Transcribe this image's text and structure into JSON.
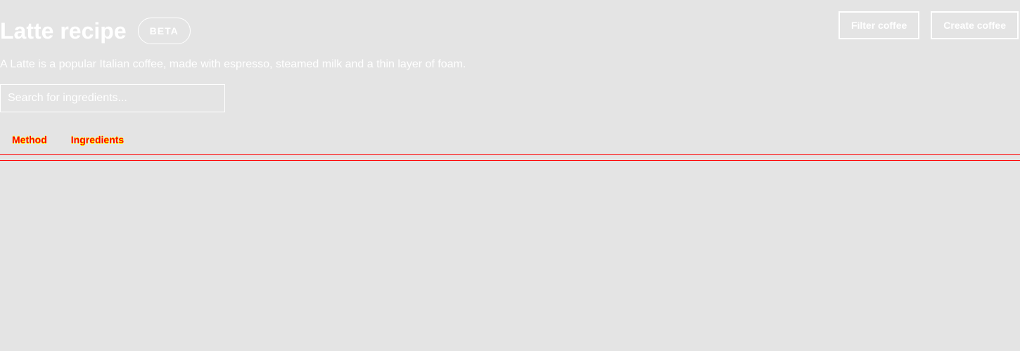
{
  "header": {
    "title": "Latte recipe",
    "badge": "BETA",
    "description": "A Latte is a popular Italian coffee, made with espresso, steamed milk and a thin layer of foam."
  },
  "actions": {
    "filter_label": "Filter coffee",
    "create_label": "Create coffee"
  },
  "search": {
    "placeholder": "Search for ingredients...",
    "value": ""
  },
  "tabs": [
    {
      "label": "Method"
    },
    {
      "label": "Ingredients"
    }
  ],
  "colors": {
    "background": "#e4e4e4",
    "text": "#ffffff",
    "tab_text": "#ff0000",
    "tab_highlight": "#ffff00",
    "divider": "#ff0000"
  }
}
